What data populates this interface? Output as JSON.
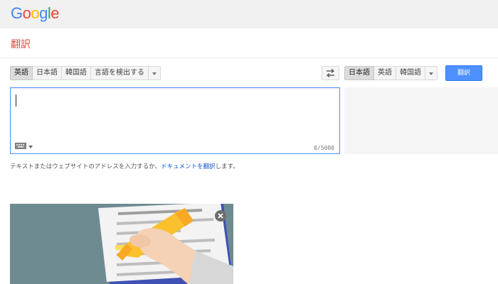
{
  "logo": {
    "letters": [
      "G",
      "o",
      "o",
      "g",
      "l",
      "e"
    ],
    "colors": [
      "#4285f4",
      "#ea4335",
      "#fbbc05",
      "#4285f4",
      "#34a853",
      "#ea4335"
    ]
  },
  "app_title": "翻訳",
  "source_langs": [
    "英語",
    "日本語",
    "韓国語",
    "言語を検出する"
  ],
  "target_langs": [
    "日本語",
    "英語",
    "韓国語"
  ],
  "translate_label": "翻訳",
  "char_count": "0/5000",
  "hint": {
    "before": "テキストまたはウェブサイトのアドレスを入力するか、",
    "link": "ドキュメントを翻訳",
    "after": "します。"
  },
  "colors": {
    "accent": "#4d90fe",
    "title": "#dd4b39",
    "link": "#1155cc"
  },
  "icons": [
    "swap-icon",
    "keyboard-icon",
    "chevron-down-icon",
    "close-icon"
  ]
}
